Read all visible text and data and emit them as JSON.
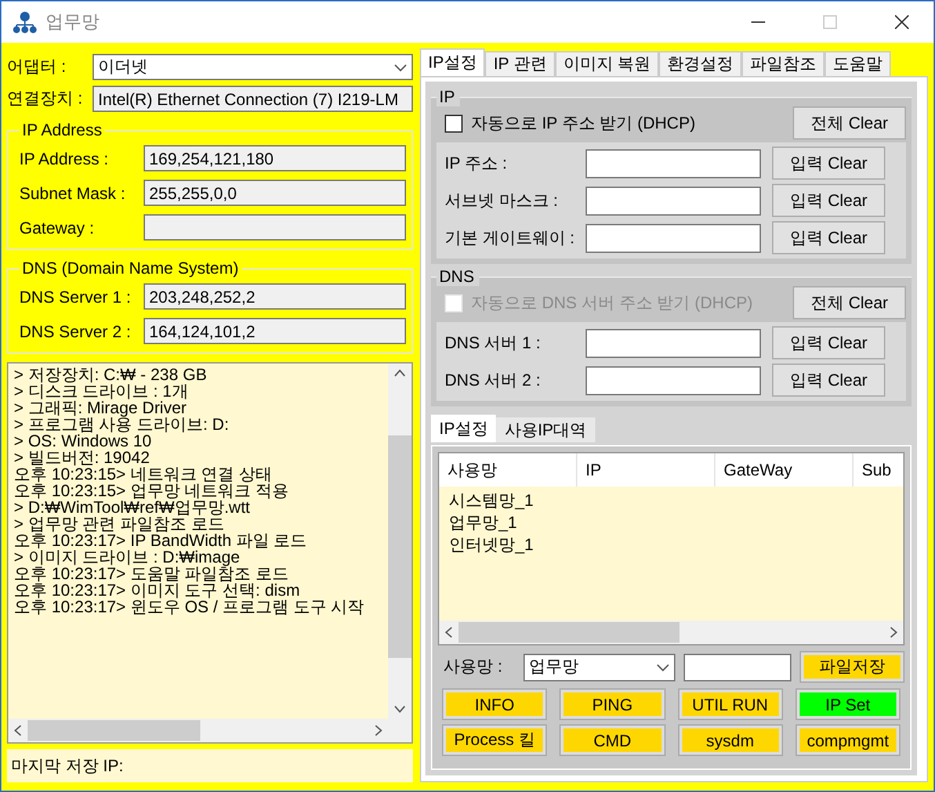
{
  "window": {
    "title": "업무망"
  },
  "adapter": {
    "label": "어댑터 :",
    "value": "이더넷"
  },
  "device": {
    "label": "연결장치 :",
    "value": "Intel(R) Ethernet Connection (7) I219-LM"
  },
  "ip_address": {
    "title": "IP Address",
    "fields": [
      {
        "label": "IP Address :",
        "value": "169,254,121,180"
      },
      {
        "label": "Subnet Mask :",
        "value": "255,255,0,0"
      },
      {
        "label": "Gateway :"
      }
    ]
  },
  "dns": {
    "title": "DNS (Domain Name System)",
    "fields": [
      {
        "label": "DNS Server 1 :",
        "value": "203,248,252,2"
      },
      {
        "label": "DNS Server 2 :",
        "value": "164,124,101,2"
      }
    ]
  },
  "log": {
    "lines": [
      "> 저장장치: C:₩ - 238 GB",
      "> 디스크 드라이브 : 1개",
      "> 그래픽: Mirage Driver",
      "> 프로그램 사용 드라이브: D:",
      "> OS: Windows 10",
      "> 빌드버전: 19042",
      "오후 10:23:15> 네트워크 연결 상태",
      "오후 10:23:15> 업무망 네트워크 적용",
      "> D:₩WimTool₩ref₩업무망.wtt",
      "> 업무망 관련 파일참조 로드",
      "오후 10:23:17> IP BandWidth 파일 로드",
      "> 이미지 드라이브 : D:₩image",
      "오후 10:23:17> 도움말 파일참조 로드",
      "오후 10:23:17> 이미지 도구 선택: dism",
      "오후 10:23:17> 윈도우 OS / 프로그램 도구 시작"
    ]
  },
  "last_saved": {
    "label": "마지막 저장 IP:"
  },
  "tabs": [
    {
      "label": "IP설정",
      "selected": true
    },
    {
      "label": "IP 관련",
      "selected": false
    },
    {
      "label": "이미지 복원",
      "selected": false
    },
    {
      "label": "환경설정",
      "selected": false
    },
    {
      "label": "파일참조",
      "selected": false
    },
    {
      "label": "도움말",
      "selected": false
    }
  ],
  "ip_group": {
    "title": "IP",
    "dhcp": {
      "label": "자동으로 IP 주소 받기 (DHCP)",
      "checked": false,
      "disabled": false
    },
    "clear_all": "전체 Clear",
    "fields": [
      {
        "label": "IP 주소 :",
        "button": "입력 Clear"
      },
      {
        "label": "서브넷 마스크 :",
        "button": "입력 Clear"
      },
      {
        "label": "기본 게이트웨이 :",
        "button": "입력 Clear"
      }
    ]
  },
  "dns_group": {
    "title": "DNS",
    "dhcp": {
      "label": "자동으로 DNS 서버 주소 받기 (DHCP)",
      "checked": false,
      "disabled": true
    },
    "clear_all": "전체 Clear",
    "fields": [
      {
        "label": "DNS 서버 1 :",
        "button": "입력 Clear"
      },
      {
        "label": "DNS 서버 2 :",
        "button": "입력 Clear"
      }
    ]
  },
  "sub_tabs": [
    {
      "label": "IP설정",
      "selected": true
    },
    {
      "label": "사용IP대역",
      "selected": false
    }
  ],
  "list": {
    "columns": [
      "사용망",
      "IP",
      "GateWay",
      "Sub"
    ],
    "rows": [
      "시스템망_1",
      "업무망_1",
      "인터넷망_1"
    ]
  },
  "network": {
    "label": "사용망 :",
    "value": "업무망"
  },
  "save_button": "파일저장",
  "buttons": [
    {
      "label": "INFO",
      "color": "#ffd700"
    },
    {
      "label": "PING",
      "color": "#ffd700"
    },
    {
      "label": "UTIL RUN",
      "color": "#ffd700"
    },
    {
      "label": "IP Set",
      "color": "#00ff00"
    },
    {
      "label": "Process 킬",
      "color": "#ffd700"
    },
    {
      "label": "CMD",
      "color": "#ffd700"
    },
    {
      "label": "sysdm",
      "color": "#ffd700"
    },
    {
      "label": "compmgmt",
      "color": "#ffd700"
    }
  ]
}
